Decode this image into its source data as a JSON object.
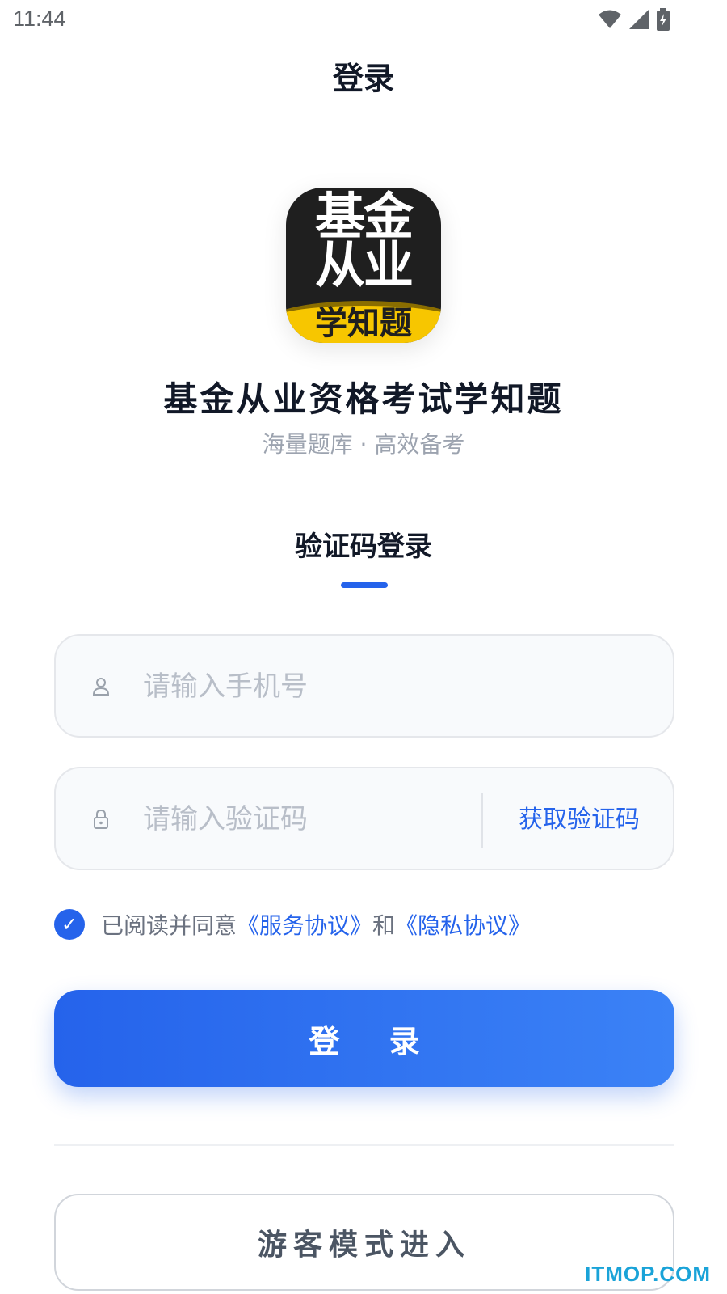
{
  "status_bar": {
    "time": "11:44",
    "icons": [
      "wifi-icon",
      "signal-icon",
      "battery-icon"
    ]
  },
  "header": {
    "title": "登录"
  },
  "app": {
    "logo_lines": [
      "基金",
      "从业",
      "学知题"
    ],
    "name": "基金从业资格考试学知题",
    "slogan": "海量题库 · 高效备考"
  },
  "login_tab": {
    "label": "验证码登录"
  },
  "phone_field": {
    "placeholder": "请输入手机号",
    "value": "",
    "icon": "user-icon"
  },
  "code_field": {
    "placeholder": "请输入验证码",
    "value": "",
    "icon": "lock-icon",
    "get_code_label": "获取验证码"
  },
  "agreement": {
    "checked": true,
    "check_mark": "✓",
    "prefix": "已阅读并同意",
    "service_link": "《服务协议》",
    "conjunction": "和",
    "privacy_link": "《隐私协议》"
  },
  "buttons": {
    "login": "登 录",
    "guest": "游客模式进入"
  },
  "watermark": "ITMOP.COM",
  "colors": {
    "accent": "#2563eb",
    "accent_light": "#3b82f6",
    "logo_yellow": "#f7c600",
    "logo_dark": "#1f1f1f"
  }
}
